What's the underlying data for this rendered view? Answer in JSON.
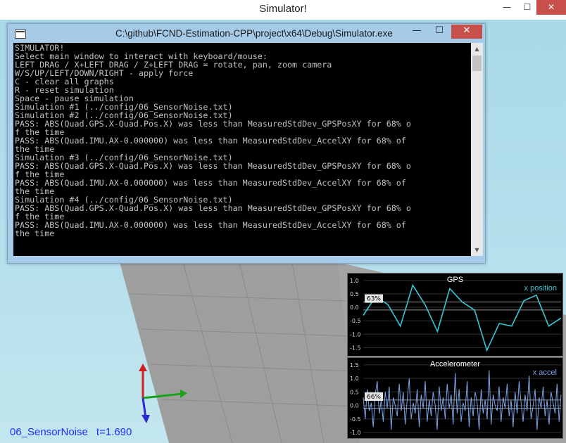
{
  "window": {
    "title": "Simulator!",
    "controls": {
      "minimize": "—",
      "maximize": "☐",
      "close": "✕"
    }
  },
  "console": {
    "title": "C:\\github\\FCND-Estimation-CPP\\project\\x64\\Debug\\Simulator.exe",
    "controls": {
      "minimize": "—",
      "maximize": "☐",
      "close": "✕"
    },
    "lines": [
      "SIMULATOR!",
      "Select main window to interact with keyboard/mouse:",
      "LEFT DRAG / X+LEFT DRAG / Z+LEFT DRAG = rotate, pan, zoom camera",
      "W/S/UP/LEFT/DOWN/RIGHT - apply force",
      "C - clear all graphs",
      "R - reset simulation",
      "Space - pause simulation",
      "Simulation #1 (../config/06_SensorNoise.txt)",
      "Simulation #2 (../config/06_SensorNoise.txt)",
      "PASS: ABS(Quad.GPS.X-Quad.Pos.X) was less than MeasuredStdDev_GPSPosXY for 68% o",
      "f the time",
      "PASS: ABS(Quad.IMU.AX-0.000000) was less than MeasuredStdDev_AccelXY for 68% of",
      "the time",
      "Simulation #3 (../config/06_SensorNoise.txt)",
      "PASS: ABS(Quad.GPS.X-Quad.Pos.X) was less than MeasuredStdDev_GPSPosXY for 68% o",
      "f the time",
      "PASS: ABS(Quad.IMU.AX-0.000000) was less than MeasuredStdDev_AccelXY for 68% of",
      "the time",
      "Simulation #4 (../config/06_SensorNoise.txt)",
      "PASS: ABS(Quad.GPS.X-Quad.Pos.X) was less than MeasuredStdDev_GPSPosXY for 68% o",
      "f the time",
      "PASS: ABS(Quad.IMU.AX-0.000000) was less than MeasuredStdDev_AccelXY for 68% of",
      "the time"
    ]
  },
  "status": {
    "scenario": "06_SensorNoise",
    "time": "t=1.690"
  },
  "colors": {
    "axis_x": "#1aa31a",
    "axis_y": "#2a2ad0",
    "axis_z": "#d02020",
    "gps_series": "#38c7d6",
    "accel_series": "#7aa6ea",
    "threshold": "#9a9a9a",
    "status_text": "#2030ff"
  },
  "chart_data": [
    {
      "type": "line",
      "title": "GPS",
      "ylim": [
        -1.7,
        1.1
      ],
      "yticks": [
        "1.0",
        "0.5",
        "0.0",
        "-0.5",
        "-1.0",
        "-1.5"
      ],
      "threshold_band": [
        -0.1,
        0.2
      ],
      "badge": "63%",
      "series": [
        {
          "name": "x position",
          "values": [
            -0.3,
            0.4,
            0.1,
            -0.7,
            0.82,
            0.1,
            -0.9,
            0.7,
            0.2,
            -0.1,
            -1.6,
            -0.6,
            -0.7,
            0.25,
            0.45,
            -0.7,
            -0.4
          ]
        }
      ]
    },
    {
      "type": "line",
      "title": "Accelerometer",
      "ylim": [
        -1.1,
        1.6
      ],
      "yticks": [
        "1.5",
        "1.0",
        "0.5",
        "0.0",
        "-0.5",
        "-1.0"
      ],
      "threshold_band": [
        -0.1,
        0.2
      ],
      "badge": "66%",
      "series": [
        {
          "name": "x accel",
          "values": [
            0.3,
            -0.5,
            0.6,
            -0.2,
            0.1,
            -0.8,
            0.4,
            0.9,
            -0.3,
            0.2,
            -0.6,
            0.5,
            -0.1,
            0.7,
            -0.9,
            0.3,
            0.0,
            -0.4,
            0.8,
            -0.2,
            0.5,
            -0.7,
            0.2,
            1.0,
            -0.5,
            0.1,
            -0.3,
            0.6,
            -0.8,
            0.4,
            -0.1,
            0.9,
            -0.6,
            0.2,
            -0.4,
            0.5,
            0.0,
            -0.9,
            0.7,
            -0.2,
            0.3,
            -0.5,
            0.8,
            -0.1,
            0.4,
            -0.7,
            1.2,
            -0.3,
            0.6,
            -0.6,
            0.1,
            -0.2,
            0.9,
            -0.8,
            0.3,
            -0.4,
            0.5,
            0.1,
            -0.9,
            0.6,
            -0.3,
            0.2,
            -0.5,
            1.3,
            -0.7,
            0.4,
            0.0,
            -0.2,
            0.7,
            -0.6,
            0.3,
            -0.1,
            0.8,
            -0.4,
            0.2,
            -0.8,
            0.5,
            -0.3,
            0.9,
            0.1,
            -0.6,
            0.4,
            -0.2,
            1.1,
            -0.5,
            0.0,
            0.6,
            -0.9,
            0.3,
            -0.1,
            0.7,
            -0.4,
            0.2,
            -0.7,
            0.5,
            0.1,
            -0.3,
            0.8,
            -0.6,
            0.4
          ]
        }
      ]
    }
  ]
}
